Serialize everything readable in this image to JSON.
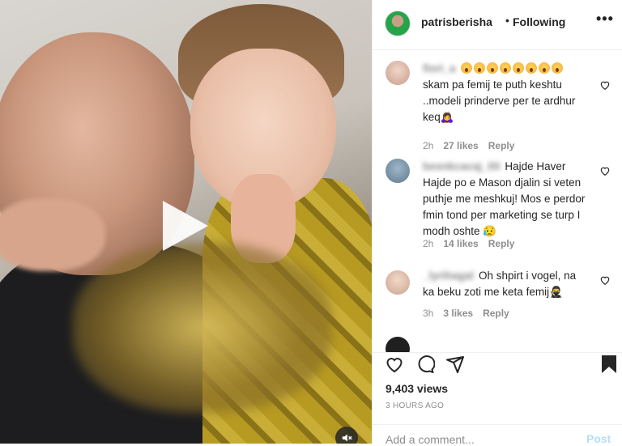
{
  "post": {
    "username": "patrisberisha",
    "separator": "•",
    "follow_state": "Following",
    "more_label": "•••"
  },
  "comments": [
    {
      "username": "fiori_a",
      "text": "skam pa femij te puth keshtu ..modeli prinderve per te ardhur keq🙇‍♀️",
      "emoji_prefix": "😮😮😮😮😮😮😮😮",
      "age": "2h",
      "likes": "27 likes",
      "reply": "Reply"
    },
    {
      "username": "besnkcacaj_00",
      "text": "Hajde Haver Hajde po e Mason djalin si veten puthje me meshkuj! Mos e perdor fmin tond per marketing se turp I modh oshte 😥",
      "age": "2h",
      "likes": "14 likes",
      "reply": "Reply"
    },
    {
      "username": "_lyrihagal",
      "text": "Oh shpirt i vogel, na ka beku zoti me keta femij🥷",
      "age": "3h",
      "likes": "3 likes",
      "reply": "Reply"
    }
  ],
  "actions": {
    "views": "9,403 views",
    "posted_time": "3 HOURS AGO",
    "add_comment_placeholder": "Add a comment...",
    "post_button": "Post"
  },
  "icons": {
    "heart": "heart-icon",
    "comment": "comment-icon",
    "share": "share-icon",
    "save": "bookmark-icon",
    "play": "play-icon",
    "mute": "mute-icon"
  }
}
